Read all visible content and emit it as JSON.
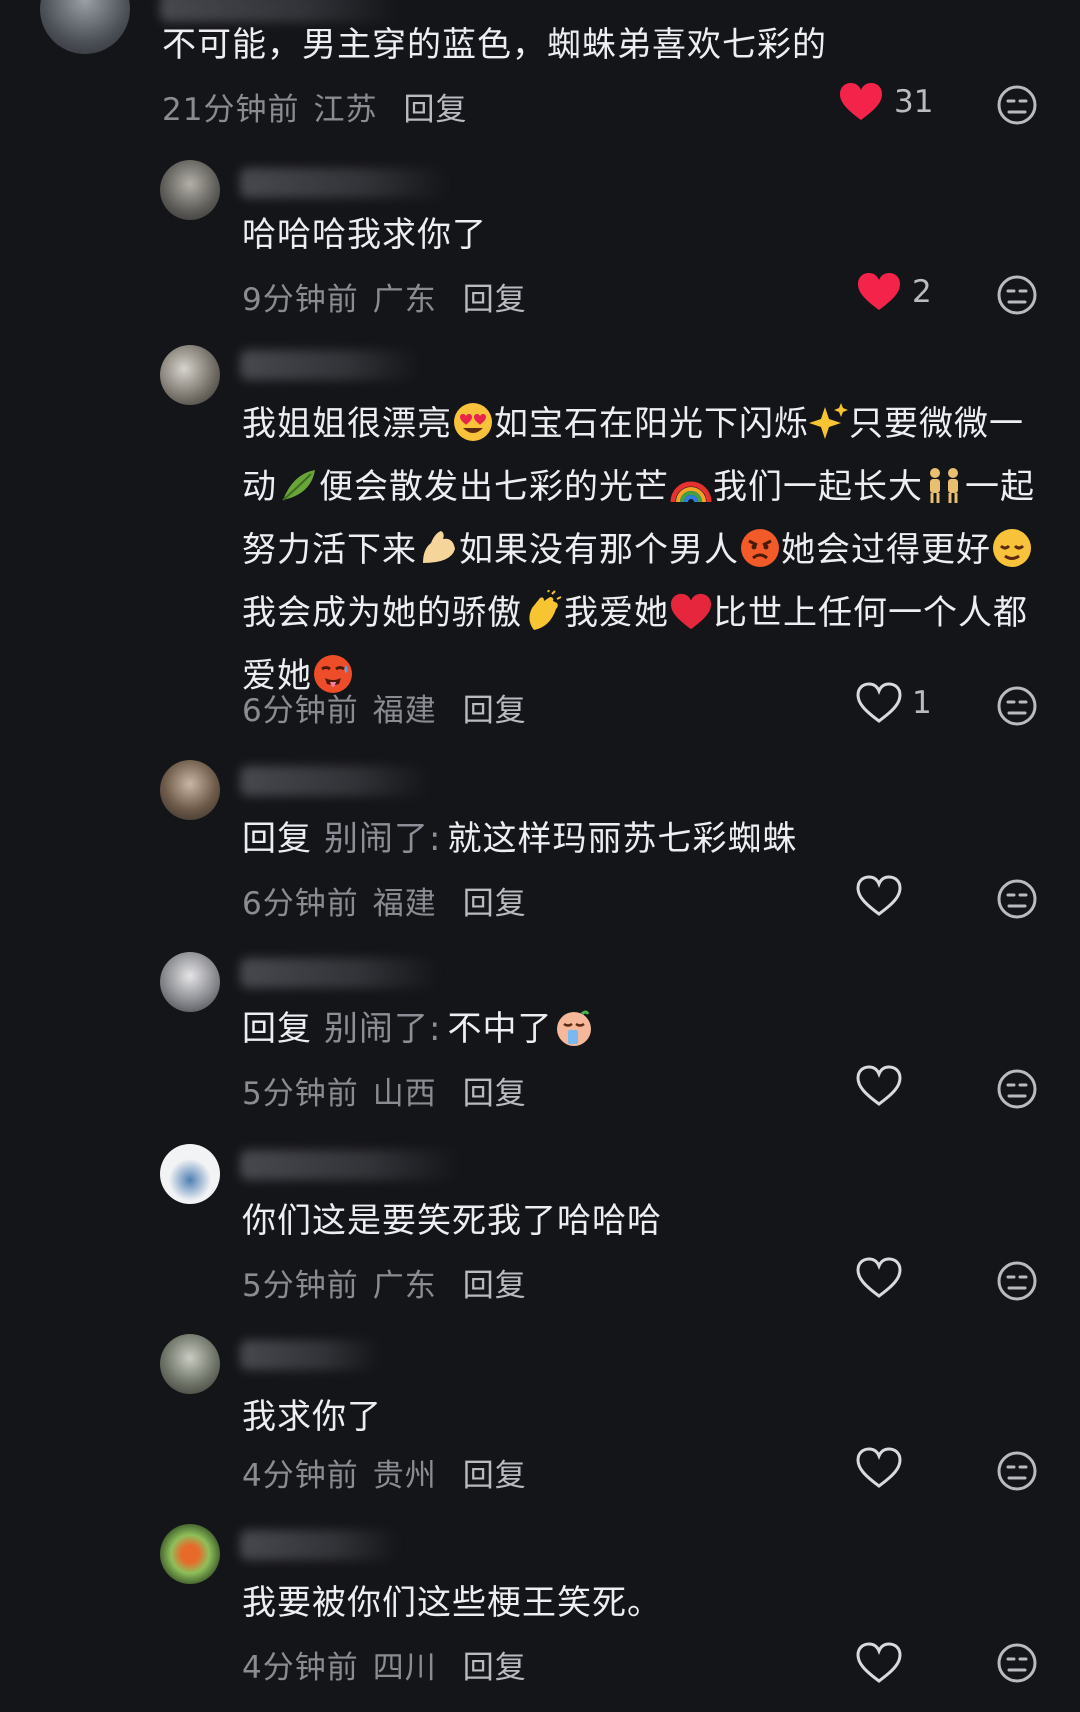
{
  "comments": [
    {
      "text": "不可能，男主穿的蓝色，蜘蛛弟喜欢七彩的",
      "time": "21分钟前",
      "location": "江苏",
      "reply": "回复",
      "likes": "31",
      "liked": true
    },
    {
      "text": "哈哈哈我求你了",
      "time": "9分钟前",
      "location": "广东",
      "reply": "回复",
      "likes": "2",
      "liked": true
    },
    {
      "parts": [
        "我姐姐很漂亮",
        "如宝石在阳光下闪烁",
        "只要微微一动",
        "便会散发出七彩的光芒",
        "我们一起长大",
        "一起努力活下来",
        "如果没有那个男人",
        "她会过得更好",
        "我会成为她的骄傲",
        "我爱她",
        "比世上任何一个人都爱她"
      ],
      "time": "6分钟前",
      "location": "福建",
      "reply": "回复",
      "likes": "1",
      "liked": false
    },
    {
      "prefix": "回复",
      "quoted": "别闹了:",
      "text": "就这样玛丽苏七彩蜘蛛",
      "time": "6分钟前",
      "location": "福建",
      "reply": "回复",
      "likes": "",
      "liked": false
    },
    {
      "prefix": "回复",
      "quoted": "别闹了:",
      "text": "不中了",
      "time": "5分钟前",
      "location": "山西",
      "reply": "回复",
      "likes": "",
      "liked": false
    },
    {
      "text": "你们这是要笑死我了哈哈哈",
      "time": "5分钟前",
      "location": "广东",
      "reply": "回复",
      "likes": "",
      "liked": false
    },
    {
      "text": "我求你了",
      "time": "4分钟前",
      "location": "贵州",
      "reply": "回复",
      "likes": "",
      "liked": false
    },
    {
      "text": "我要被你们这些梗王笑死。",
      "time": "4分钟前",
      "location": "四川",
      "reply": "回复",
      "likes": "",
      "liked": false
    }
  ],
  "icons": {
    "liked": "heart-filled-icon",
    "unliked": "heart-outline-icon",
    "dislike": "meh-face-icon"
  },
  "colors": {
    "background": "#141519",
    "liked_heart": "#f4234a",
    "muted_text": "#8a8c92"
  }
}
